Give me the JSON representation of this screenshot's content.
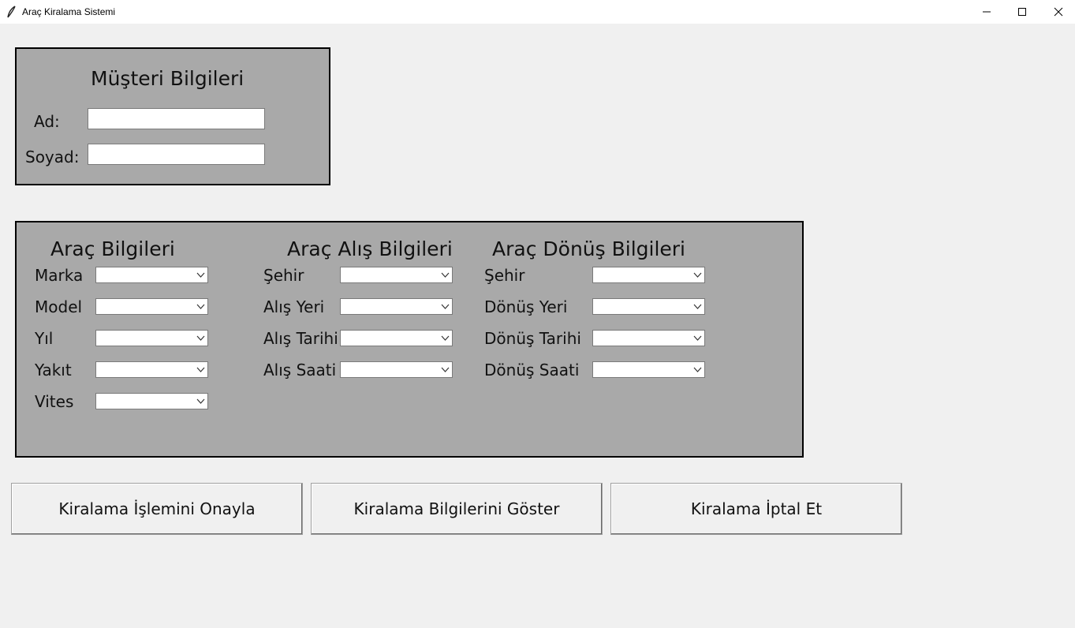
{
  "window": {
    "title": "Araç Kiralama Sistemi"
  },
  "customer": {
    "heading": "Müşteri Bilgileri",
    "name_label": "Ad:",
    "name_value": "",
    "surname_label": "Soyad:",
    "surname_value": ""
  },
  "vehicle": {
    "heading": "Araç Bilgileri",
    "fields": [
      "Marka",
      "Model",
      "Yıl",
      "Yakıt",
      "Vites"
    ]
  },
  "pickup": {
    "heading": "Araç Alış Bilgileri",
    "fields": [
      "Şehir",
      "Alış Yeri",
      "Alış Tarihi",
      "Alış Saati"
    ]
  },
  "return": {
    "heading": "Araç Dönüş Bilgileri",
    "fields": [
      "Şehir",
      "Dönüş Yeri",
      "Dönüş Tarihi",
      "Dönüş Saati"
    ]
  },
  "actions": {
    "confirm": "Kiralama İşlemini Onayla",
    "show": "Kiralama Bilgilerini Göster",
    "cancel": "Kiralama İptal Et"
  }
}
